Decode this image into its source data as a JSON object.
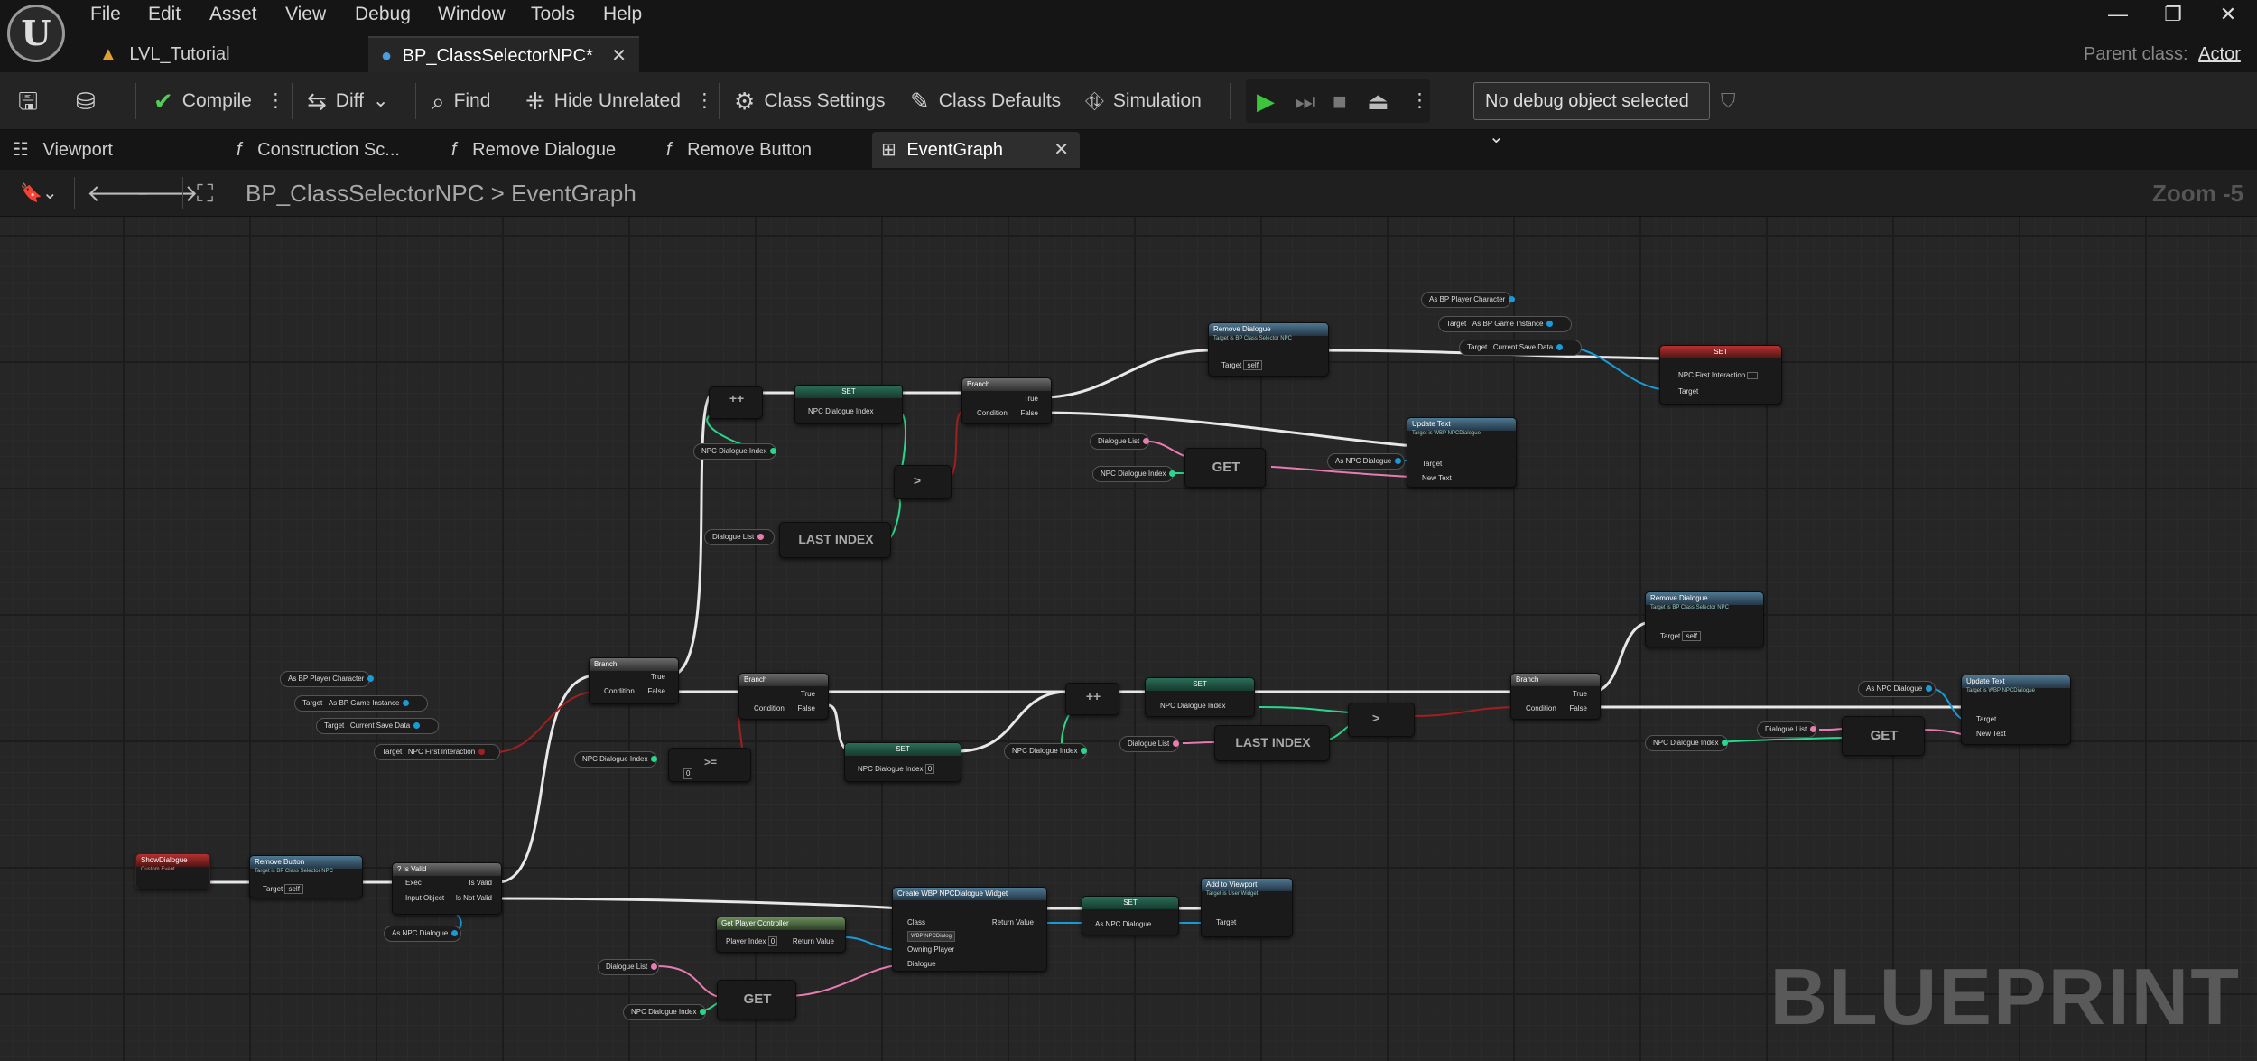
{
  "menu": [
    "File",
    "Edit",
    "Asset",
    "View",
    "Debug",
    "Window",
    "Tools",
    "Help"
  ],
  "tabs": {
    "level": "LVL_Tutorial",
    "blueprint": "BP_ClassSelectorNPC*"
  },
  "parent": {
    "label": "Parent class:",
    "value": "Actor"
  },
  "toolbar": {
    "compile": "Compile",
    "diff": "Diff",
    "find": "Find",
    "hide_unrelated": "Hide Unrelated",
    "class_settings": "Class Settings",
    "class_defaults": "Class Defaults",
    "simulation": "Simulation",
    "debug_select": "No debug object selected"
  },
  "doc_tabs": {
    "viewport": "Viewport",
    "construction": "Construction Sc...",
    "remove_dialogue": "Remove Dialogue",
    "remove_button": "Remove Button",
    "event_graph": "EventGraph"
  },
  "breadcrumb": {
    "blueprint": "BP_ClassSelectorNPC",
    "separator": ">",
    "graph": "EventGraph"
  },
  "zoom": "Zoom -5",
  "watermark": "BLUEPRINT",
  "colors": {
    "exec": "#ffffff",
    "object": "#1a9bd7",
    "bool": "#a11f1f",
    "int": "#2ad68c",
    "text": "#e87bb0",
    "array": "#e87bb0"
  },
  "nodes": {
    "show_dialogue": {
      "title": "ShowDialogue",
      "sub": "Custom Event"
    },
    "remove_button": {
      "title": "Remove Button",
      "sub": "Target is BP Class Selector NPC",
      "target": "Target",
      "self": "self"
    },
    "is_valid": {
      "title": "Is Valid",
      "exec": "Exec",
      "input": "Input Object",
      "valid": "Is Valid",
      "not_valid": "Is Not Valid"
    },
    "as_npc_dialogue": "As NPC Dialogue",
    "branch": "Branch",
    "condition": "Condition",
    "true": "True",
    "false": "False",
    "as_bp_player": "As BP Player Character",
    "target": "Target",
    "as_bp_game": "As BP Game Instance",
    "current_save": "Current Save Data",
    "npc_first": "NPC First Interaction",
    "npc_dialogue_index": "NPC Dialogue Index",
    "dialogue_list": "Dialogue List",
    "set": "SET",
    "get": "GET",
    "last_index": "LAST INDEX",
    "plusplus": "++",
    "greater": ">",
    "gte": ">=",
    "remove_dialogue": {
      "title": "Remove Dialogue",
      "sub": "Target is BP Class Selector NPC"
    },
    "update_text": {
      "title": "Update Text",
      "sub": "Target is WBP NPCDialogue",
      "target": "Target",
      "new_text": "New Text"
    },
    "create_widget": {
      "title": "Create WBP NPCDialogue Widget",
      "class": "Class",
      "class_value": "WBP NPCDialog",
      "owning": "Owning Player",
      "dialogue": "Dialogue",
      "return": "Return Value"
    },
    "get_player_controller": {
      "title": "Get Player Controller",
      "player_index": "Player Index",
      "return": "Return Value",
      "zero": "0"
    },
    "add_to_viewport": {
      "title": "Add to Viewport",
      "sub": "Target is User Widget",
      "target": "Target"
    }
  }
}
